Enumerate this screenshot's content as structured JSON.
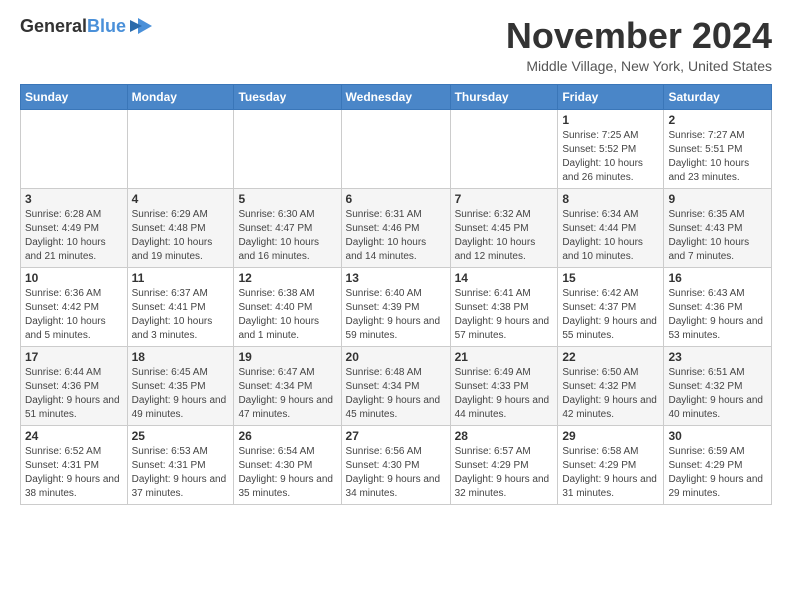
{
  "logo": {
    "general": "General",
    "blue": "Blue"
  },
  "header": {
    "month": "November 2024",
    "location": "Middle Village, New York, United States"
  },
  "weekdays": [
    "Sunday",
    "Monday",
    "Tuesday",
    "Wednesday",
    "Thursday",
    "Friday",
    "Saturday"
  ],
  "weeks": [
    [
      {
        "day": "",
        "info": ""
      },
      {
        "day": "",
        "info": ""
      },
      {
        "day": "",
        "info": ""
      },
      {
        "day": "",
        "info": ""
      },
      {
        "day": "",
        "info": ""
      },
      {
        "day": "1",
        "info": "Sunrise: 7:25 AM\nSunset: 5:52 PM\nDaylight: 10 hours and 26 minutes."
      },
      {
        "day": "2",
        "info": "Sunrise: 7:27 AM\nSunset: 5:51 PM\nDaylight: 10 hours and 23 minutes."
      }
    ],
    [
      {
        "day": "3",
        "info": "Sunrise: 6:28 AM\nSunset: 4:49 PM\nDaylight: 10 hours and 21 minutes."
      },
      {
        "day": "4",
        "info": "Sunrise: 6:29 AM\nSunset: 4:48 PM\nDaylight: 10 hours and 19 minutes."
      },
      {
        "day": "5",
        "info": "Sunrise: 6:30 AM\nSunset: 4:47 PM\nDaylight: 10 hours and 16 minutes."
      },
      {
        "day": "6",
        "info": "Sunrise: 6:31 AM\nSunset: 4:46 PM\nDaylight: 10 hours and 14 minutes."
      },
      {
        "day": "7",
        "info": "Sunrise: 6:32 AM\nSunset: 4:45 PM\nDaylight: 10 hours and 12 minutes."
      },
      {
        "day": "8",
        "info": "Sunrise: 6:34 AM\nSunset: 4:44 PM\nDaylight: 10 hours and 10 minutes."
      },
      {
        "day": "9",
        "info": "Sunrise: 6:35 AM\nSunset: 4:43 PM\nDaylight: 10 hours and 7 minutes."
      }
    ],
    [
      {
        "day": "10",
        "info": "Sunrise: 6:36 AM\nSunset: 4:42 PM\nDaylight: 10 hours and 5 minutes."
      },
      {
        "day": "11",
        "info": "Sunrise: 6:37 AM\nSunset: 4:41 PM\nDaylight: 10 hours and 3 minutes."
      },
      {
        "day": "12",
        "info": "Sunrise: 6:38 AM\nSunset: 4:40 PM\nDaylight: 10 hours and 1 minute."
      },
      {
        "day": "13",
        "info": "Sunrise: 6:40 AM\nSunset: 4:39 PM\nDaylight: 9 hours and 59 minutes."
      },
      {
        "day": "14",
        "info": "Sunrise: 6:41 AM\nSunset: 4:38 PM\nDaylight: 9 hours and 57 minutes."
      },
      {
        "day": "15",
        "info": "Sunrise: 6:42 AM\nSunset: 4:37 PM\nDaylight: 9 hours and 55 minutes."
      },
      {
        "day": "16",
        "info": "Sunrise: 6:43 AM\nSunset: 4:36 PM\nDaylight: 9 hours and 53 minutes."
      }
    ],
    [
      {
        "day": "17",
        "info": "Sunrise: 6:44 AM\nSunset: 4:36 PM\nDaylight: 9 hours and 51 minutes."
      },
      {
        "day": "18",
        "info": "Sunrise: 6:45 AM\nSunset: 4:35 PM\nDaylight: 9 hours and 49 minutes."
      },
      {
        "day": "19",
        "info": "Sunrise: 6:47 AM\nSunset: 4:34 PM\nDaylight: 9 hours and 47 minutes."
      },
      {
        "day": "20",
        "info": "Sunrise: 6:48 AM\nSunset: 4:34 PM\nDaylight: 9 hours and 45 minutes."
      },
      {
        "day": "21",
        "info": "Sunrise: 6:49 AM\nSunset: 4:33 PM\nDaylight: 9 hours and 44 minutes."
      },
      {
        "day": "22",
        "info": "Sunrise: 6:50 AM\nSunset: 4:32 PM\nDaylight: 9 hours and 42 minutes."
      },
      {
        "day": "23",
        "info": "Sunrise: 6:51 AM\nSunset: 4:32 PM\nDaylight: 9 hours and 40 minutes."
      }
    ],
    [
      {
        "day": "24",
        "info": "Sunrise: 6:52 AM\nSunset: 4:31 PM\nDaylight: 9 hours and 38 minutes."
      },
      {
        "day": "25",
        "info": "Sunrise: 6:53 AM\nSunset: 4:31 PM\nDaylight: 9 hours and 37 minutes."
      },
      {
        "day": "26",
        "info": "Sunrise: 6:54 AM\nSunset: 4:30 PM\nDaylight: 9 hours and 35 minutes."
      },
      {
        "day": "27",
        "info": "Sunrise: 6:56 AM\nSunset: 4:30 PM\nDaylight: 9 hours and 34 minutes."
      },
      {
        "day": "28",
        "info": "Sunrise: 6:57 AM\nSunset: 4:29 PM\nDaylight: 9 hours and 32 minutes."
      },
      {
        "day": "29",
        "info": "Sunrise: 6:58 AM\nSunset: 4:29 PM\nDaylight: 9 hours and 31 minutes."
      },
      {
        "day": "30",
        "info": "Sunrise: 6:59 AM\nSunset: 4:29 PM\nDaylight: 9 hours and 29 minutes."
      }
    ]
  ]
}
